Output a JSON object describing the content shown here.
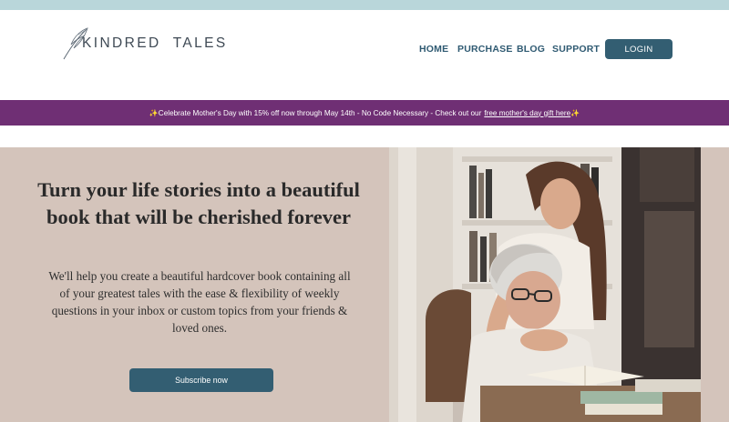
{
  "brand": {
    "name": "KINDRED  TALES"
  },
  "nav": {
    "items": [
      {
        "label": "HOME"
      },
      {
        "label": "PURCHASE"
      },
      {
        "label": "BLOG"
      },
      {
        "label": "SUPPORT"
      }
    ],
    "login_label": "LOGIN"
  },
  "promo": {
    "sparkle_left": "✨",
    "text": "Celebrate Mother's Day with 15% off now through May 14th - No Code Necessary - Check out our ",
    "link_text": "free mother's day gift here",
    "sparkle_right": "✨"
  },
  "hero": {
    "title": "Turn your life stories into a beautiful book that will be cherished forever",
    "description": "We'll help you create a beautiful hardcover book containing all of your greatest tales with the ease & flexibility of weekly questions in your inbox or custom topics from your friends & loved ones.",
    "cta_label": "Subscribe now"
  },
  "colors": {
    "top_strip": "#b9d6da",
    "promo_bg": "#6f2f74",
    "hero_bg": "#d4c4bb",
    "button_bg": "#335e72",
    "nav_text": "#2f5a72"
  }
}
